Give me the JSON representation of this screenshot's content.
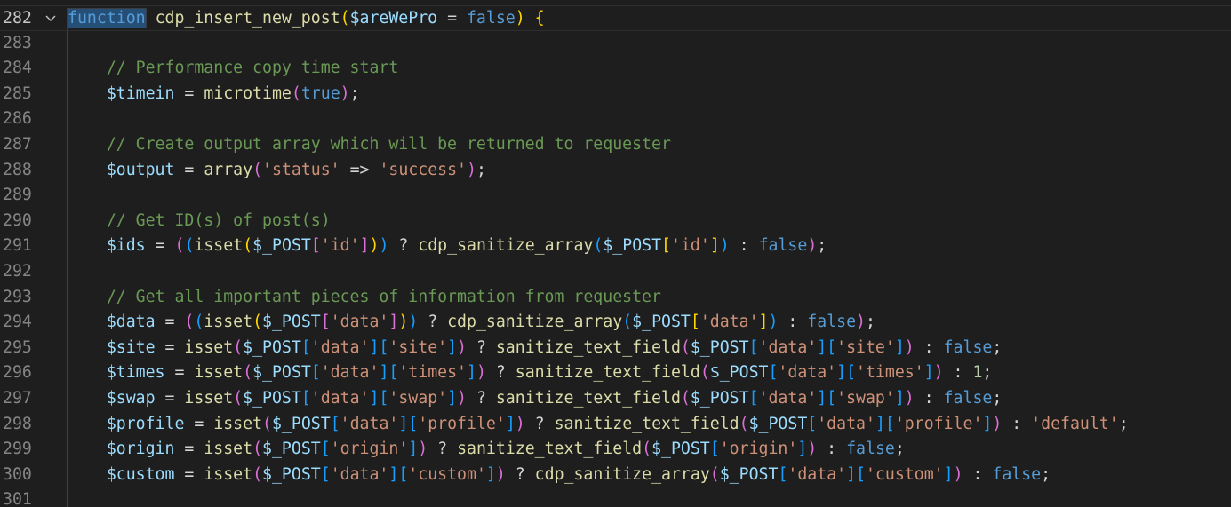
{
  "editor": {
    "language": "php",
    "theme_colors": {
      "background": "#1e1e1e",
      "keyword": "#569cd6",
      "function": "#dcdcaa",
      "variable": "#9cdcfe",
      "string": "#ce9178",
      "comment": "#6a9955",
      "number": "#b5cea8",
      "bracket_level_1": "#ffd700",
      "bracket_level_2": "#da70d6",
      "bracket_level_3": "#179fff"
    },
    "fold_icon": "chevron-down-icon",
    "lines": [
      {
        "number": "282",
        "tokens": [
          [
            "kw",
            "function"
          ],
          [
            "op",
            " "
          ],
          [
            "fn",
            "cdp_insert_new_post"
          ],
          [
            "b1",
            "("
          ],
          [
            "var",
            "$areWePro"
          ],
          [
            "op",
            " = "
          ],
          [
            "kw",
            "false"
          ],
          [
            "b1",
            ")"
          ],
          [
            "op",
            " "
          ],
          [
            "b1",
            "{"
          ]
        ]
      },
      {
        "number": "283",
        "tokens": []
      },
      {
        "number": "284",
        "tokens": [
          [
            "op",
            "    "
          ],
          [
            "com",
            "// Performance copy time start"
          ]
        ]
      },
      {
        "number": "285",
        "tokens": [
          [
            "op",
            "    "
          ],
          [
            "var",
            "$timein"
          ],
          [
            "op",
            " = "
          ],
          [
            "fn",
            "microtime"
          ],
          [
            "b2",
            "("
          ],
          [
            "kw",
            "true"
          ],
          [
            "b2",
            ")"
          ],
          [
            "op",
            ";"
          ]
        ]
      },
      {
        "number": "286",
        "tokens": []
      },
      {
        "number": "287",
        "tokens": [
          [
            "op",
            "    "
          ],
          [
            "com",
            "// Create output array which will be returned to requester"
          ]
        ]
      },
      {
        "number": "288",
        "tokens": [
          [
            "op",
            "    "
          ],
          [
            "var",
            "$output"
          ],
          [
            "op",
            " = "
          ],
          [
            "fn",
            "array"
          ],
          [
            "b2",
            "("
          ],
          [
            "str",
            "'status'"
          ],
          [
            "op",
            " => "
          ],
          [
            "str",
            "'success'"
          ],
          [
            "b2",
            ")"
          ],
          [
            "op",
            ";"
          ]
        ]
      },
      {
        "number": "289",
        "tokens": []
      },
      {
        "number": "290",
        "tokens": [
          [
            "op",
            "    "
          ],
          [
            "com",
            "// Get ID(s) of post(s)"
          ]
        ]
      },
      {
        "number": "291",
        "tokens": [
          [
            "op",
            "    "
          ],
          [
            "var",
            "$ids"
          ],
          [
            "op",
            " = "
          ],
          [
            "b2",
            "("
          ],
          [
            "b3",
            "("
          ],
          [
            "fn",
            "isset"
          ],
          [
            "b1",
            "("
          ],
          [
            "var",
            "$_POST"
          ],
          [
            "b2",
            "["
          ],
          [
            "str",
            "'id'"
          ],
          [
            "b2",
            "]"
          ],
          [
            "b1",
            ")"
          ],
          [
            "b3",
            ")"
          ],
          [
            "op",
            " ? "
          ],
          [
            "fn",
            "cdp_sanitize_array"
          ],
          [
            "b3",
            "("
          ],
          [
            "var",
            "$_POST"
          ],
          [
            "b1",
            "["
          ],
          [
            "str",
            "'id'"
          ],
          [
            "b1",
            "]"
          ],
          [
            "b3",
            ")"
          ],
          [
            "op",
            " : "
          ],
          [
            "kw",
            "false"
          ],
          [
            "b2",
            ")"
          ],
          [
            "op",
            ";"
          ]
        ]
      },
      {
        "number": "292",
        "tokens": []
      },
      {
        "number": "293",
        "tokens": [
          [
            "op",
            "    "
          ],
          [
            "com",
            "// Get all important pieces of information from requester"
          ]
        ]
      },
      {
        "number": "294",
        "tokens": [
          [
            "op",
            "    "
          ],
          [
            "var",
            "$data"
          ],
          [
            "op",
            " = "
          ],
          [
            "b2",
            "("
          ],
          [
            "b3",
            "("
          ],
          [
            "fn",
            "isset"
          ],
          [
            "b1",
            "("
          ],
          [
            "var",
            "$_POST"
          ],
          [
            "b2",
            "["
          ],
          [
            "str",
            "'data'"
          ],
          [
            "b2",
            "]"
          ],
          [
            "b1",
            ")"
          ],
          [
            "b3",
            ")"
          ],
          [
            "op",
            " ? "
          ],
          [
            "fn",
            "cdp_sanitize_array"
          ],
          [
            "b3",
            "("
          ],
          [
            "var",
            "$_POST"
          ],
          [
            "b1",
            "["
          ],
          [
            "str",
            "'data'"
          ],
          [
            "b1",
            "]"
          ],
          [
            "b3",
            ")"
          ],
          [
            "op",
            " : "
          ],
          [
            "kw",
            "false"
          ],
          [
            "b2",
            ")"
          ],
          [
            "op",
            ";"
          ]
        ]
      },
      {
        "number": "295",
        "tokens": [
          [
            "op",
            "    "
          ],
          [
            "var",
            "$site"
          ],
          [
            "op",
            " = "
          ],
          [
            "fn",
            "isset"
          ],
          [
            "b2",
            "("
          ],
          [
            "var",
            "$_POST"
          ],
          [
            "b3",
            "["
          ],
          [
            "str",
            "'data'"
          ],
          [
            "b3",
            "]["
          ],
          [
            "str",
            "'site'"
          ],
          [
            "b3",
            "]"
          ],
          [
            "b2",
            ")"
          ],
          [
            "op",
            " ? "
          ],
          [
            "fn",
            "sanitize_text_field"
          ],
          [
            "b2",
            "("
          ],
          [
            "var",
            "$_POST"
          ],
          [
            "b3",
            "["
          ],
          [
            "str",
            "'data'"
          ],
          [
            "b3",
            "]["
          ],
          [
            "str",
            "'site'"
          ],
          [
            "b3",
            "]"
          ],
          [
            "b2",
            ")"
          ],
          [
            "op",
            " : "
          ],
          [
            "kw",
            "false"
          ],
          [
            "op",
            ";"
          ]
        ]
      },
      {
        "number": "296",
        "tokens": [
          [
            "op",
            "    "
          ],
          [
            "var",
            "$times"
          ],
          [
            "op",
            " = "
          ],
          [
            "fn",
            "isset"
          ],
          [
            "b2",
            "("
          ],
          [
            "var",
            "$_POST"
          ],
          [
            "b3",
            "["
          ],
          [
            "str",
            "'data'"
          ],
          [
            "b3",
            "]["
          ],
          [
            "str",
            "'times'"
          ],
          [
            "b3",
            "]"
          ],
          [
            "b2",
            ")"
          ],
          [
            "op",
            " ? "
          ],
          [
            "fn",
            "sanitize_text_field"
          ],
          [
            "b2",
            "("
          ],
          [
            "var",
            "$_POST"
          ],
          [
            "b3",
            "["
          ],
          [
            "str",
            "'data'"
          ],
          [
            "b3",
            "]["
          ],
          [
            "str",
            "'times'"
          ],
          [
            "b3",
            "]"
          ],
          [
            "b2",
            ")"
          ],
          [
            "op",
            " : "
          ],
          [
            "num",
            "1"
          ],
          [
            "op",
            ";"
          ]
        ]
      },
      {
        "number": "297",
        "tokens": [
          [
            "op",
            "    "
          ],
          [
            "var",
            "$swap"
          ],
          [
            "op",
            " = "
          ],
          [
            "fn",
            "isset"
          ],
          [
            "b2",
            "("
          ],
          [
            "var",
            "$_POST"
          ],
          [
            "b3",
            "["
          ],
          [
            "str",
            "'data'"
          ],
          [
            "b3",
            "]["
          ],
          [
            "str",
            "'swap'"
          ],
          [
            "b3",
            "]"
          ],
          [
            "b2",
            ")"
          ],
          [
            "op",
            " ? "
          ],
          [
            "fn",
            "sanitize_text_field"
          ],
          [
            "b2",
            "("
          ],
          [
            "var",
            "$_POST"
          ],
          [
            "b3",
            "["
          ],
          [
            "str",
            "'data'"
          ],
          [
            "b3",
            "]["
          ],
          [
            "str",
            "'swap'"
          ],
          [
            "b3",
            "]"
          ],
          [
            "b2",
            ")"
          ],
          [
            "op",
            " : "
          ],
          [
            "kw",
            "false"
          ],
          [
            "op",
            ";"
          ]
        ]
      },
      {
        "number": "298",
        "tokens": [
          [
            "op",
            "    "
          ],
          [
            "var",
            "$profile"
          ],
          [
            "op",
            " = "
          ],
          [
            "fn",
            "isset"
          ],
          [
            "b2",
            "("
          ],
          [
            "var",
            "$_POST"
          ],
          [
            "b3",
            "["
          ],
          [
            "str",
            "'data'"
          ],
          [
            "b3",
            "]["
          ],
          [
            "str",
            "'profile'"
          ],
          [
            "b3",
            "]"
          ],
          [
            "b2",
            ")"
          ],
          [
            "op",
            " ? "
          ],
          [
            "fn",
            "sanitize_text_field"
          ],
          [
            "b2",
            "("
          ],
          [
            "var",
            "$_POST"
          ],
          [
            "b3",
            "["
          ],
          [
            "str",
            "'data'"
          ],
          [
            "b3",
            "]["
          ],
          [
            "str",
            "'profile'"
          ],
          [
            "b3",
            "]"
          ],
          [
            "b2",
            ")"
          ],
          [
            "op",
            " : "
          ],
          [
            "str",
            "'default'"
          ],
          [
            "op",
            ";"
          ]
        ]
      },
      {
        "number": "299",
        "tokens": [
          [
            "op",
            "    "
          ],
          [
            "var",
            "$origin"
          ],
          [
            "op",
            " = "
          ],
          [
            "fn",
            "isset"
          ],
          [
            "b2",
            "("
          ],
          [
            "var",
            "$_POST"
          ],
          [
            "b3",
            "["
          ],
          [
            "str",
            "'origin'"
          ],
          [
            "b3",
            "]"
          ],
          [
            "b2",
            ")"
          ],
          [
            "op",
            " ? "
          ],
          [
            "fn",
            "sanitize_text_field"
          ],
          [
            "b2",
            "("
          ],
          [
            "var",
            "$_POST"
          ],
          [
            "b3",
            "["
          ],
          [
            "str",
            "'origin'"
          ],
          [
            "b3",
            "]"
          ],
          [
            "b2",
            ")"
          ],
          [
            "op",
            " : "
          ],
          [
            "kw",
            "false"
          ],
          [
            "op",
            ";"
          ]
        ]
      },
      {
        "number": "300",
        "tokens": [
          [
            "op",
            "    "
          ],
          [
            "var",
            "$custom"
          ],
          [
            "op",
            " = "
          ],
          [
            "fn",
            "isset"
          ],
          [
            "b2",
            "("
          ],
          [
            "var",
            "$_POST"
          ],
          [
            "b3",
            "["
          ],
          [
            "str",
            "'data'"
          ],
          [
            "b3",
            "]["
          ],
          [
            "str",
            "'custom'"
          ],
          [
            "b3",
            "]"
          ],
          [
            "b2",
            ")"
          ],
          [
            "op",
            " ? "
          ],
          [
            "fn",
            "cdp_sanitize_array"
          ],
          [
            "b2",
            "("
          ],
          [
            "var",
            "$_POST"
          ],
          [
            "b3",
            "["
          ],
          [
            "str",
            "'data'"
          ],
          [
            "b3",
            "]["
          ],
          [
            "str",
            "'custom'"
          ],
          [
            "b3",
            "]"
          ],
          [
            "b2",
            ")"
          ],
          [
            "op",
            " : "
          ],
          [
            "kw",
            "false"
          ],
          [
            "op",
            ";"
          ]
        ]
      },
      {
        "number": "301",
        "tokens": []
      }
    ]
  }
}
